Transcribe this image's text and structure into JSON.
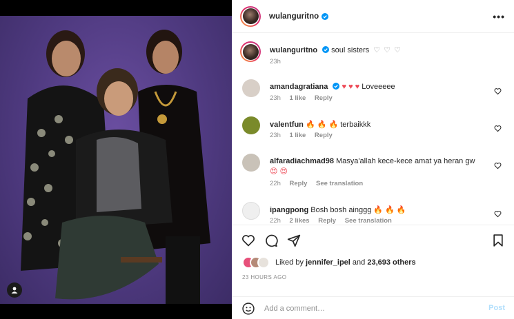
{
  "post": {
    "username": "wulanguritno",
    "more_label": "•••"
  },
  "caption": {
    "username": "wulanguritno",
    "text": "soul sisters",
    "hearts": "♡ ♡ ♡",
    "time": "23h"
  },
  "comments": [
    {
      "username": "amandagratiana",
      "text_prefix": "",
      "emoji": "♥ ♥ ♥",
      "emoji_color": "#ed4956",
      "text": "Loveeeee",
      "emoji_after": "",
      "time": "23h",
      "likes": "1 like",
      "reply": "Reply",
      "translation": "",
      "avatar_color": "#d8cfc7"
    },
    {
      "username": "valentfun",
      "text_prefix": "",
      "emoji": "🔥 🔥 🔥",
      "emoji_color": "#f26a1b",
      "text": "terbaikkk",
      "emoji_after": "",
      "time": "23h",
      "likes": "1 like",
      "reply": "Reply",
      "translation": "",
      "avatar_color": "#7a8a2a"
    },
    {
      "username": "alfaradiachmad98",
      "text_prefix": "Masya'allah kece-kece amat ya heran gw",
      "emoji": "",
      "emoji_color": "#ed4956",
      "text": "",
      "emoji_after": "😍 😍",
      "time": "22h",
      "likes": "",
      "reply": "Reply",
      "translation": "See translation",
      "avatar_color": "#c9c2b8"
    },
    {
      "username": "ipangpong",
      "text_prefix": "Bosh bosh ainggg",
      "emoji": "🔥 🔥 🔥",
      "emoji_color": "#f26a1b",
      "text": "",
      "emoji_after": "",
      "time": "22h",
      "likes": "2 likes",
      "reply": "Reply",
      "translation": "See translation",
      "avatar_color": "#efefef"
    }
  ],
  "likes": {
    "prefix": "Liked by",
    "user": "jennifer_ipel",
    "middle": "and",
    "count": "23,693 others"
  },
  "timestamp": "23 HOURS AGO",
  "add_comment": {
    "placeholder": "Add a comment…",
    "post_label": "Post"
  },
  "colors": {
    "accent_blue": "#0095f6",
    "post_disabled": "#b2dffc",
    "like_red": "#ed4956",
    "photo_backdrop": "#4f3a80"
  }
}
